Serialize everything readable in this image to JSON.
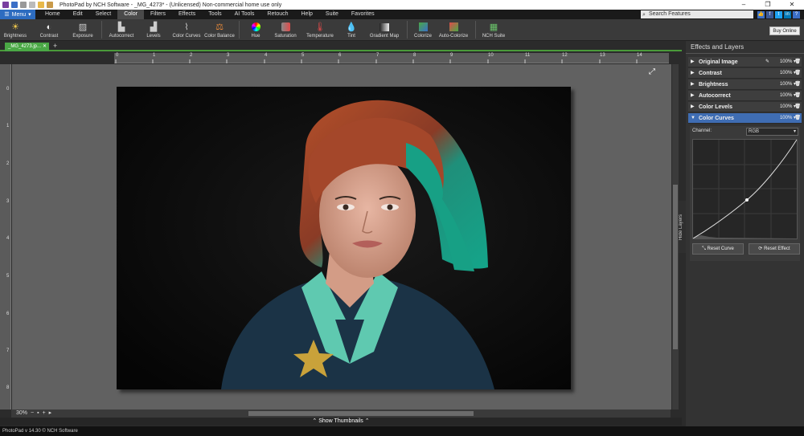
{
  "window": {
    "title": "PhotoPad by NCH Software - _MG_4273* - (Unlicensed) Non-commercial home use only",
    "controls": [
      "–",
      "❐",
      "✕"
    ]
  },
  "menubar": {
    "menu_label": "Menu",
    "tabs": [
      "Home",
      "Edit",
      "Select",
      "Color",
      "Filters",
      "Effects",
      "Tools",
      "AI Tools",
      "Retouch",
      "Help",
      "Suite",
      "Favorites"
    ],
    "active_tab": "Color",
    "search_placeholder": "Search Features"
  },
  "toolbar": {
    "tools": [
      "Brightness",
      "Contrast",
      "Exposure",
      "Autocorrect",
      "Levels",
      "Color Curves",
      "Color Balance",
      "Hue",
      "Saturation",
      "Temperature",
      "Tint",
      "Gradient Map",
      "Colorize",
      "Auto-Colorize",
      "NCH Suite"
    ],
    "buy_label": "Buy Online"
  },
  "document": {
    "tab_label": "_MG_4273.jp...",
    "zoom": "30%",
    "ruler_h": [
      "0",
      "1",
      "2",
      "3",
      "4",
      "5",
      "6",
      "7",
      "8",
      "9",
      "10",
      "11",
      "12",
      "13",
      "14"
    ],
    "ruler_v": [
      "0",
      "1",
      "2",
      "3",
      "4",
      "5",
      "6",
      "7",
      "8"
    ]
  },
  "thumbnails": {
    "label": "⌃ Show Thumbnails ⌃"
  },
  "status": {
    "text": "PhotoPad v 14.30 © NCH Software"
  },
  "side": {
    "hide_layers": "Hide Layers"
  },
  "panel": {
    "title": "Effects and Layers",
    "layers": [
      {
        "name": "Original Image",
        "opacity": "100%"
      },
      {
        "name": "Contrast",
        "opacity": "100%"
      },
      {
        "name": "Brightness",
        "opacity": "100%"
      },
      {
        "name": "Autocorrect",
        "opacity": "100%"
      },
      {
        "name": "Color Levels",
        "opacity": "100%"
      },
      {
        "name": "Color Curves",
        "opacity": "100%"
      }
    ],
    "active_layer": "Color Curves",
    "channel_label": "Channel:",
    "channel_value": "RGB",
    "reset_curve": "Reset Curve",
    "reset_effect": "Reset Effect"
  },
  "colors": {
    "accent": "#3f6db3",
    "doc_tab": "#4aa845",
    "menu": "#2d6cc0"
  }
}
